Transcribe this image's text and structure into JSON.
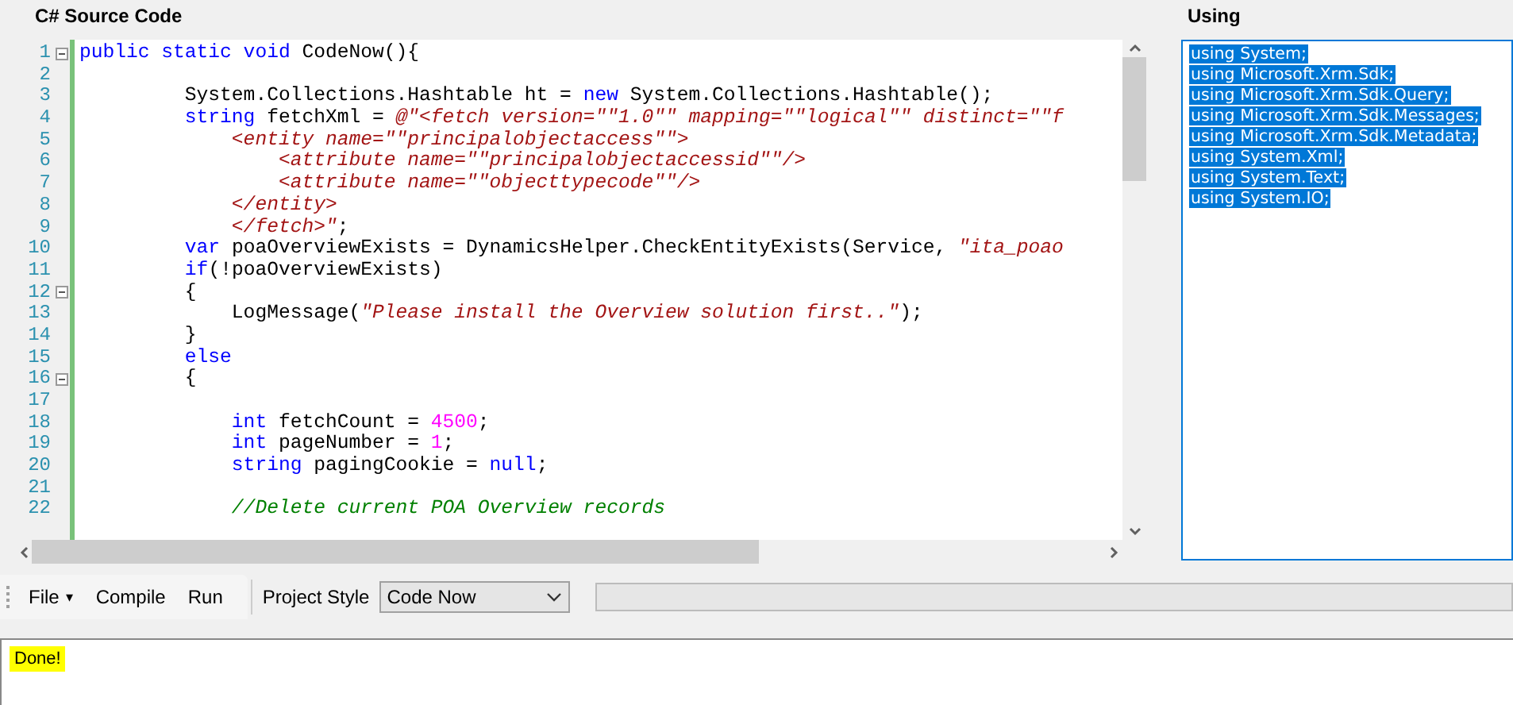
{
  "source_panel": {
    "title": "C# Source Code",
    "lines": [
      {
        "number": "1",
        "collapsible": true,
        "tokens": [
          {
            "kind": "keyword",
            "text": "public static void"
          },
          {
            "kind": "plain",
            "text": " CodeNow(){"
          }
        ]
      },
      {
        "number": "2",
        "collapsible": false
      },
      {
        "number": "3",
        "collapsible": false,
        "tokens": [
          {
            "kind": "plain",
            "text": "         System.Collections.Hashtable ht = "
          },
          {
            "kind": "keyword",
            "text": "new"
          },
          {
            "kind": "plain",
            "text": " System.Collections.Hashtable();"
          }
        ]
      },
      {
        "number": "4",
        "collapsible": false,
        "tokens": [
          {
            "kind": "keyword",
            "text": "         string"
          },
          {
            "kind": "plain",
            "text": " fetchXml = "
          },
          {
            "kind": "string",
            "text": "@\"<fetch version=\"\"1.0\"\" mapping=\"\"logical\"\" distinct=\"\"f"
          }
        ]
      },
      {
        "number": "5",
        "collapsible": false,
        "tokens": [
          {
            "kind": "string",
            "text": "             <entity name=\"\"principalobjectaccess\"\">"
          }
        ]
      },
      {
        "number": "6",
        "collapsible": false,
        "tokens": [
          {
            "kind": "string",
            "text": "                 <attribute name=\"\"principalobjectaccessid\"\"/>"
          }
        ]
      },
      {
        "number": "7",
        "collapsible": false,
        "tokens": [
          {
            "kind": "string",
            "text": "                 <attribute name=\"\"objecttypecode\"\"/>"
          }
        ]
      },
      {
        "number": "8",
        "collapsible": false,
        "tokens": [
          {
            "kind": "string",
            "text": "             </entity>"
          }
        ]
      },
      {
        "number": "9",
        "collapsible": false,
        "tokens": [
          {
            "kind": "string",
            "text": "             </fetch>\""
          },
          {
            "kind": "plain",
            "text": ";"
          }
        ]
      },
      {
        "number": "10",
        "collapsible": false,
        "tokens": [
          {
            "kind": "keyword",
            "text": "         var"
          },
          {
            "kind": "plain",
            "text": " poaOverviewExists = DynamicsHelper.CheckEntityExists(Service, "
          },
          {
            "kind": "string",
            "text": "\"ita_poao"
          }
        ]
      },
      {
        "number": "11",
        "collapsible": false,
        "tokens": [
          {
            "kind": "keyword",
            "text": "         if"
          },
          {
            "kind": "plain",
            "text": "(!poaOverviewExists)"
          }
        ]
      },
      {
        "number": "12",
        "collapsible": true,
        "tokens": [
          {
            "kind": "plain",
            "text": "         {"
          }
        ]
      },
      {
        "number": "13",
        "collapsible": false,
        "tokens": [
          {
            "kind": "plain",
            "text": "             LogMessage("
          },
          {
            "kind": "string",
            "text": "\"Please install the Overview solution first..\""
          },
          {
            "kind": "plain",
            "text": ");"
          }
        ]
      },
      {
        "number": "14",
        "collapsible": false,
        "tokens": [
          {
            "kind": "plain",
            "text": "         }"
          }
        ]
      },
      {
        "number": "15",
        "collapsible": false,
        "tokens": [
          {
            "kind": "keyword",
            "text": "         else"
          }
        ]
      },
      {
        "number": "16",
        "collapsible": true,
        "tokens": [
          {
            "kind": "plain",
            "text": "         {"
          }
        ]
      },
      {
        "number": "17",
        "collapsible": false
      },
      {
        "number": "18",
        "collapsible": false,
        "tokens": [
          {
            "kind": "keyword",
            "text": "             int"
          },
          {
            "kind": "plain",
            "text": " fetchCount = "
          },
          {
            "kind": "number",
            "text": "4500"
          },
          {
            "kind": "plain",
            "text": ";"
          }
        ]
      },
      {
        "number": "19",
        "collapsible": false,
        "tokens": [
          {
            "kind": "keyword",
            "text": "             int"
          },
          {
            "kind": "plain",
            "text": " pageNumber = "
          },
          {
            "kind": "number",
            "text": "1"
          },
          {
            "kind": "plain",
            "text": ";"
          }
        ]
      },
      {
        "number": "20",
        "collapsible": false,
        "tokens": [
          {
            "kind": "keyword",
            "text": "             string"
          },
          {
            "kind": "plain",
            "text": " pagingCookie = "
          },
          {
            "kind": "keyword",
            "text": "null"
          },
          {
            "kind": "plain",
            "text": ";"
          }
        ]
      },
      {
        "number": "21",
        "collapsible": false
      },
      {
        "number": "22",
        "collapsible": false,
        "tokens": [
          {
            "kind": "comment",
            "text": "             //Delete current POA Overview records"
          }
        ]
      }
    ]
  },
  "using_panel": {
    "title": "Using",
    "selected": true,
    "lines": [
      "using System;",
      "using Microsoft.Xrm.Sdk;",
      "using Microsoft.Xrm.Sdk.Query;",
      "using Microsoft.Xrm.Sdk.Messages;",
      "using Microsoft.Xrm.Sdk.Metadata;",
      "using System.Xml;",
      "using System.Text;",
      "using System.IO;"
    ]
  },
  "toolbar": {
    "menu": {
      "label": "File",
      "caret": "▾"
    },
    "buttons": [
      "Compile",
      "Run"
    ],
    "project_style": {
      "label": "Project Style",
      "value": "Code Now"
    },
    "progress": {
      "level": 0
    }
  },
  "output": {
    "text": "Done!",
    "highlighted": true
  }
}
